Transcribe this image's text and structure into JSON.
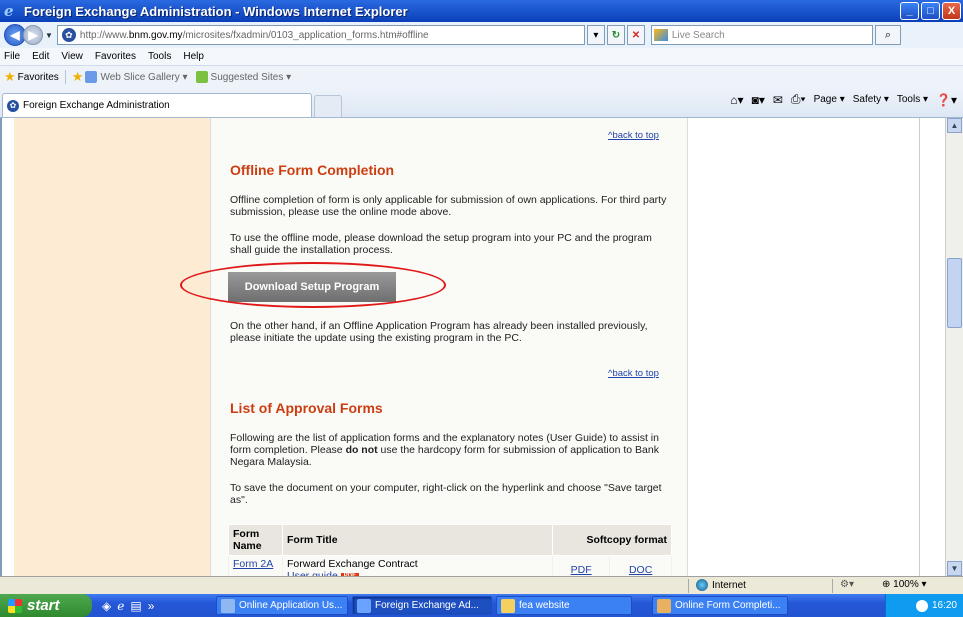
{
  "window": {
    "title": "Foreign Exchange Administration - Windows Internet Explorer",
    "controls": [
      "_",
      "□",
      "X"
    ]
  },
  "address_bar": {
    "url_prefix": "http://www.",
    "url_domain": "bnm.gov.my",
    "url_path": "/microsites/fxadmin/0103_application_forms.htm#offline",
    "search_placeholder": "Live Search"
  },
  "menu": [
    "File",
    "Edit",
    "View",
    "Favorites",
    "Tools",
    "Help"
  ],
  "favorites_bar": {
    "favorites_label": "Favorites",
    "items": [
      "Web Slice Gallery ▾",
      "Suggested Sites ▾"
    ]
  },
  "tab": {
    "label": "Foreign Exchange Administration"
  },
  "command_bar": [
    "Page ▾",
    "Safety ▾",
    "Tools ▾"
  ],
  "page": {
    "back_to_top": "^back to top",
    "offline_heading": "Offline Form Completion",
    "offline_para1": "Offline completion of form is only applicable for submission of own applications. For third party submission, please use the online mode above.",
    "offline_para2": "To use the offline mode, please download the setup program into your PC and the program shall guide the installation process.",
    "download_button": "Download Setup Program",
    "offline_para3": "On the other hand, if an Offline Application Program has already been installed previously, please initiate the update using the existing program in the PC.",
    "list_heading": "List of Approval Forms",
    "list_para1_a": "Following are the list of application forms and the explanatory notes (User Guide) to assist in form completion. Please ",
    "list_para1_b": "do not",
    "list_para1_c": " use the hardcopy form for submission of application to Bank Negara Malaysia.",
    "list_para2": "To save the document on your computer, right-click on the hyperlink and choose \"Save target as\".",
    "table": {
      "headers": [
        "Form Name",
        "Form Title",
        "Softcopy format"
      ],
      "rows": [
        {
          "form_name": "Form 2A",
          "form_title": "Forward Exchange Contract",
          "guide": "User guide",
          "badge": "PDF",
          "pdf": "PDF",
          "doc": "DOC"
        }
      ]
    }
  },
  "status_bar": {
    "zone": "Internet",
    "zoom": "100%"
  },
  "taskbar": {
    "start": "start",
    "items": [
      "Online Application Us...",
      "Foreign Exchange Ad...",
      "fea website",
      "Online Form Completi..."
    ],
    "clock": "16:20"
  }
}
